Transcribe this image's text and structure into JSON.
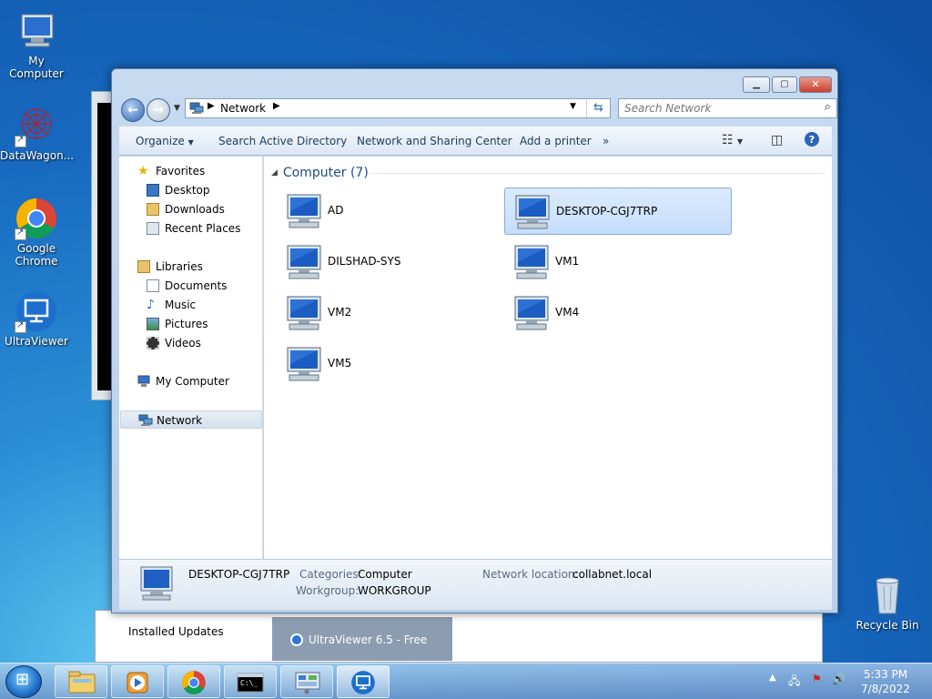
{
  "desktop": {
    "icons": [
      {
        "label": "My Computer"
      },
      {
        "label": "DataWagon..."
      },
      {
        "label": "Google Chrome"
      },
      {
        "label": "UltraViewer"
      },
      {
        "label": "Recycle Bin"
      }
    ]
  },
  "background_windows": {
    "installed_updates_label": "Installed Updates",
    "ultraviewer_popup_label": "UltraViewer 6.5 - Free"
  },
  "explorer": {
    "address": {
      "location": "Network"
    },
    "search": {
      "placeholder": "Search Network"
    },
    "command_bar": {
      "organize": "Organize",
      "search_ad": "Search Active Directory",
      "network_sharing": "Network and Sharing Center",
      "add_printer": "Add a printer",
      "more": "»"
    },
    "nav_pane": {
      "favorites": "Favorites",
      "desktop": "Desktop",
      "downloads": "Downloads",
      "recent_places": "Recent Places",
      "libraries": "Libraries",
      "documents": "Documents",
      "music": "Music",
      "pictures": "Pictures",
      "videos": "Videos",
      "my_computer": "My Computer",
      "network": "Network"
    },
    "group": {
      "header": "Computer (7)"
    },
    "computers": [
      "AD",
      "DESKTOP-CGJ7TRP",
      "DILSHAD-SYS",
      "VM1",
      "VM2",
      "VM4",
      "VM5"
    ],
    "selected_computer": "DESKTOP-CGJ7TRP",
    "details": {
      "name": "DESKTOP-CGJ7TRP",
      "categories_label": "Categories:",
      "categories_value": "Computer",
      "workgroup_label": "Workgroup:",
      "workgroup_value": "WORKGROUP",
      "network_location_label": "Network location:",
      "network_location_value": "collabnet.local"
    }
  },
  "taskbar": {
    "time": "5:33 PM",
    "date": "7/8/2022"
  }
}
